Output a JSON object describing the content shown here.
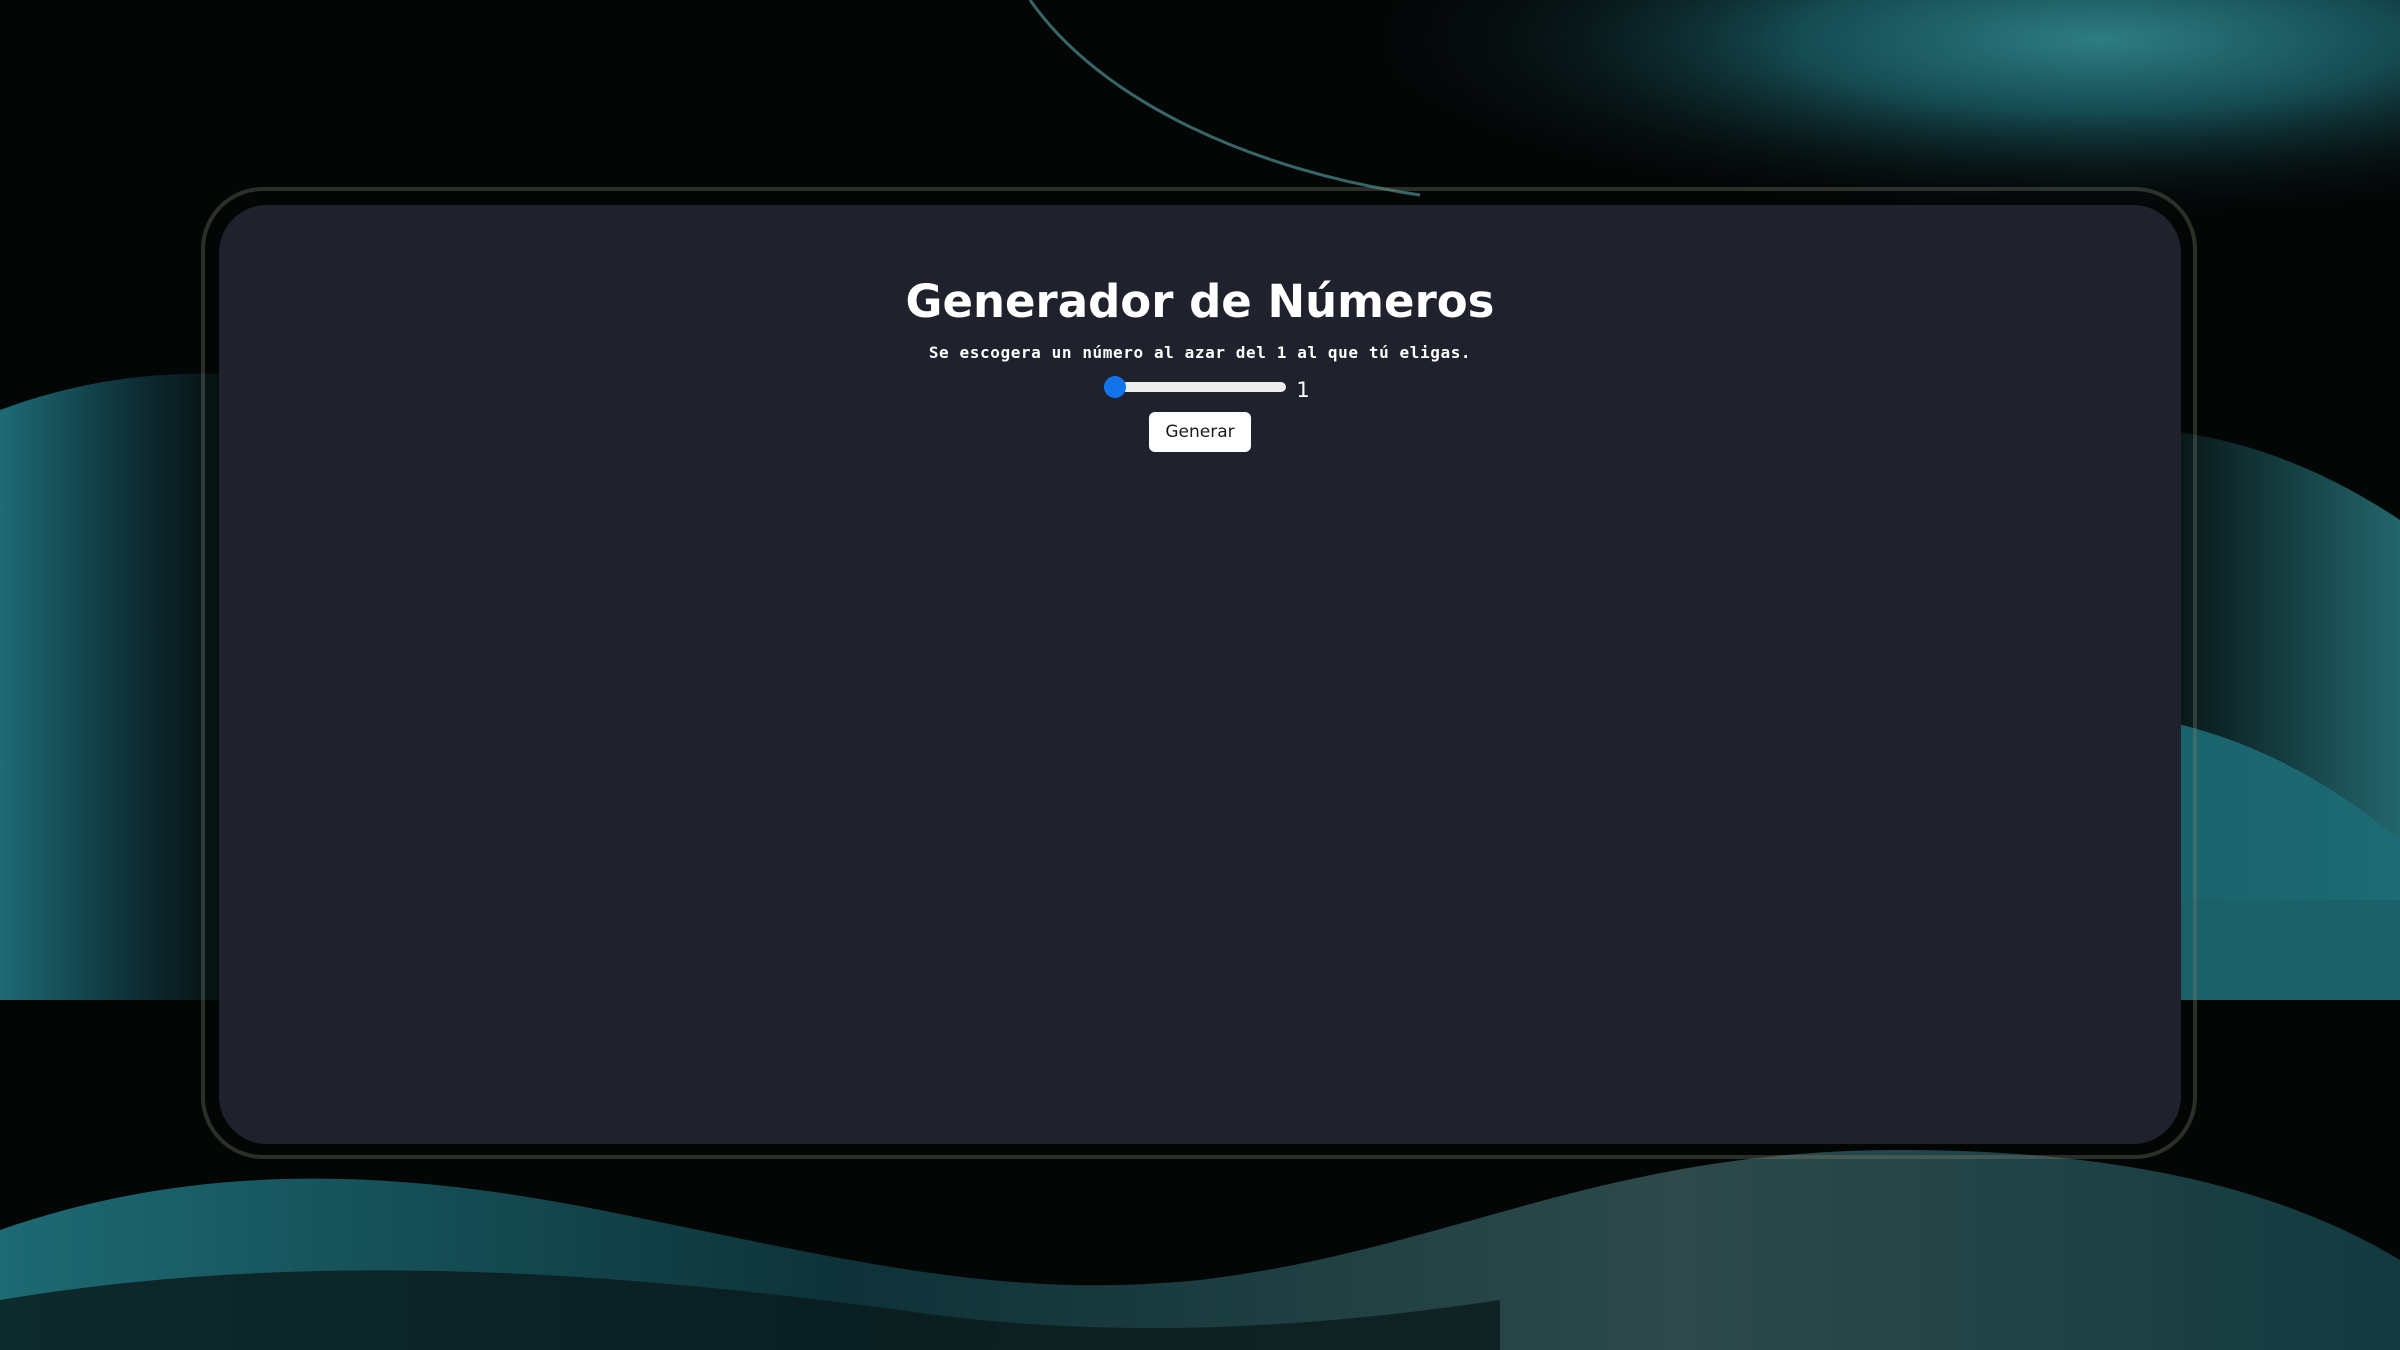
{
  "app": {
    "title": "Generador de Números",
    "subtitle": "Se escogera un número al azar del 1 al que tú eligas.",
    "slider": {
      "min": "1",
      "max": "100",
      "value": "1",
      "value_label": "1"
    },
    "generate_label": "Generar"
  },
  "colors": {
    "card": "#1f222c",
    "accent": "#1273ea",
    "wallpaper_teal": "#1f6f78",
    "text": "#ffffff"
  }
}
